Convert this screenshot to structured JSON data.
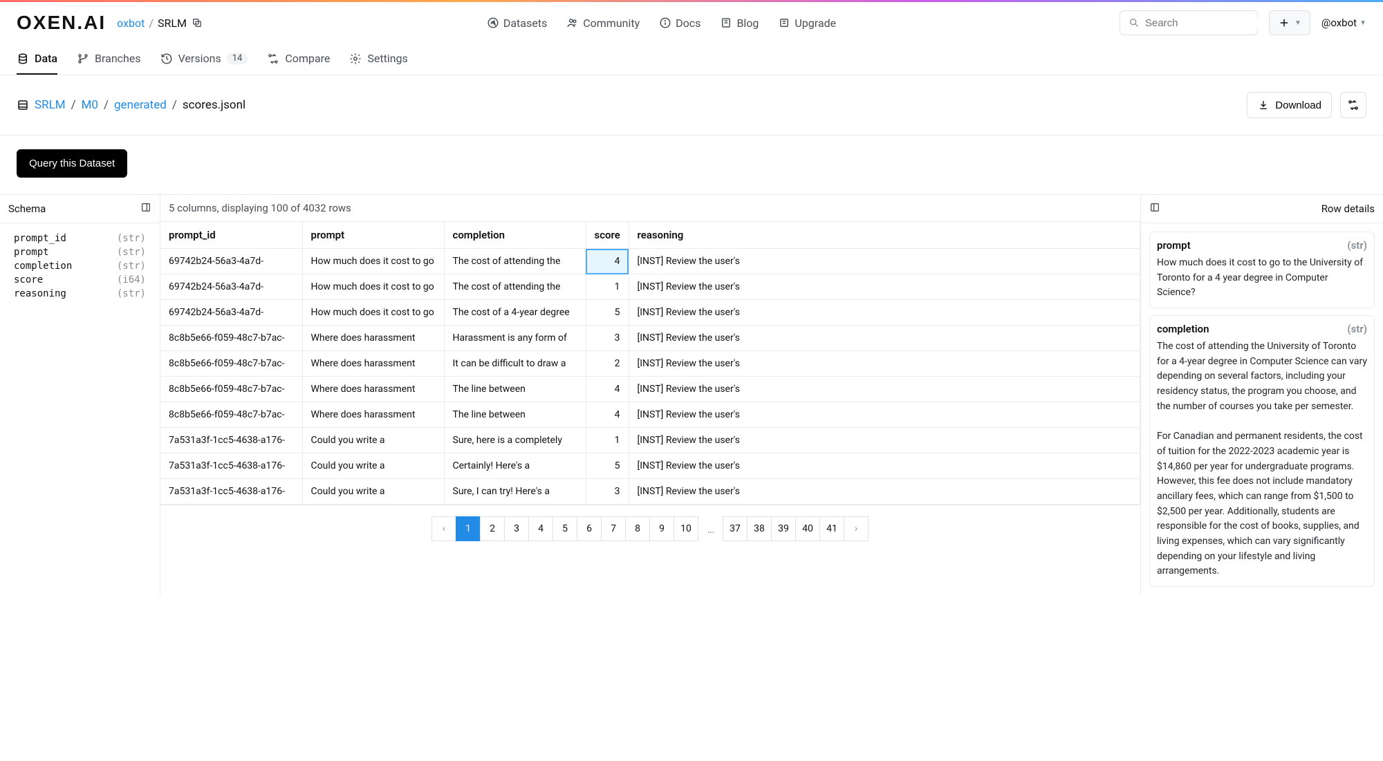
{
  "logo": "OXEN.AI",
  "owner": "oxbot",
  "repo": "SRLM",
  "nav": {
    "datasets": "Datasets",
    "community": "Community",
    "docs": "Docs",
    "blog": "Blog",
    "upgrade": "Upgrade"
  },
  "search_placeholder": "Search",
  "user": "@oxbot",
  "tabs": {
    "data": "Data",
    "branches": "Branches",
    "versions": "Versions",
    "versions_badge": "14",
    "compare": "Compare",
    "settings": "Settings"
  },
  "path": {
    "seg1": "SRLM",
    "seg2": "M0",
    "seg3": "generated",
    "file": "scores.jsonl"
  },
  "download_label": "Download",
  "query_btn": "Query this Dataset",
  "schema_title": "Schema",
  "schema": [
    {
      "name": "prompt_id",
      "type": "(str)"
    },
    {
      "name": "prompt",
      "type": "(str)"
    },
    {
      "name": "completion",
      "type": "(str)"
    },
    {
      "name": "score",
      "type": "(i64)"
    },
    {
      "name": "reasoning",
      "type": "(str)"
    }
  ],
  "table_info": "5 columns, displaying 100 of 4032 rows",
  "columns": {
    "prompt_id": "prompt_id",
    "prompt": "prompt",
    "completion": "completion",
    "score": "score",
    "reasoning": "reasoning"
  },
  "rows": [
    {
      "prompt_id": "69742b24-56a3-4a7d-",
      "prompt": "How much does it cost to go",
      "completion": "The cost of attending the",
      "score": "4",
      "reasoning": "[INST] Review the user's"
    },
    {
      "prompt_id": "69742b24-56a3-4a7d-",
      "prompt": "How much does it cost to go",
      "completion": "The cost of attending the",
      "score": "1",
      "reasoning": "[INST] Review the user's"
    },
    {
      "prompt_id": "69742b24-56a3-4a7d-",
      "prompt": "How much does it cost to go",
      "completion": "The cost of a 4-year degree",
      "score": "5",
      "reasoning": "[INST] Review the user's"
    },
    {
      "prompt_id": "8c8b5e66-f059-48c7-b7ac-",
      "prompt": "Where does harassment",
      "completion": "Harassment is any form of",
      "score": "3",
      "reasoning": "[INST] Review the user's"
    },
    {
      "prompt_id": "8c8b5e66-f059-48c7-b7ac-",
      "prompt": "Where does harassment",
      "completion": "It can be difficult to draw a",
      "score": "2",
      "reasoning": "[INST] Review the user's"
    },
    {
      "prompt_id": "8c8b5e66-f059-48c7-b7ac-",
      "prompt": "Where does harassment",
      "completion": "The line between",
      "score": "4",
      "reasoning": "[INST] Review the user's"
    },
    {
      "prompt_id": "8c8b5e66-f059-48c7-b7ac-",
      "prompt": "Where does harassment",
      "completion": "The line between",
      "score": "4",
      "reasoning": "[INST] Review the user's"
    },
    {
      "prompt_id": "7a531a3f-1cc5-4638-a176-",
      "prompt": "Could you write a",
      "completion": "Sure, here is a completely",
      "score": "1",
      "reasoning": "[INST] Review the user's"
    },
    {
      "prompt_id": "7a531a3f-1cc5-4638-a176-",
      "prompt": "Could you write a",
      "completion": "Certainly! Here's a",
      "score": "5",
      "reasoning": "[INST] Review the user's"
    },
    {
      "prompt_id": "7a531a3f-1cc5-4638-a176-",
      "prompt": "Could you write a",
      "completion": "Sure, I can try! Here's a",
      "score": "3",
      "reasoning": "[INST] Review the user's"
    }
  ],
  "pages": [
    "1",
    "2",
    "3",
    "4",
    "5",
    "6",
    "7",
    "8",
    "9",
    "10"
  ],
  "pages_end": [
    "37",
    "38",
    "39",
    "40",
    "41"
  ],
  "details_title": "Row details",
  "details": {
    "prompt_label": "prompt",
    "prompt_type": "(str)",
    "prompt_value": "How much does it cost to go to the University of Toronto for a 4 year degree in Computer Science?",
    "completion_label": "completion",
    "completion_type": "(str)",
    "completion_value": "The cost of attending the University of Toronto for a 4-year degree in Computer Science can vary depending on several factors, including your residency status, the program you choose, and the number of courses you take per semester.\n\nFor Canadian and permanent residents, the cost of tuition for the 2022-2023 academic year is $14,860 per year for undergraduate programs. However, this fee does not include mandatory ancillary fees, which can range from $1,500 to $2,500 per year. Additionally, students are responsible for the cost of books, supplies, and living expenses, which can vary significantly depending on your lifestyle and living arrangements."
  }
}
